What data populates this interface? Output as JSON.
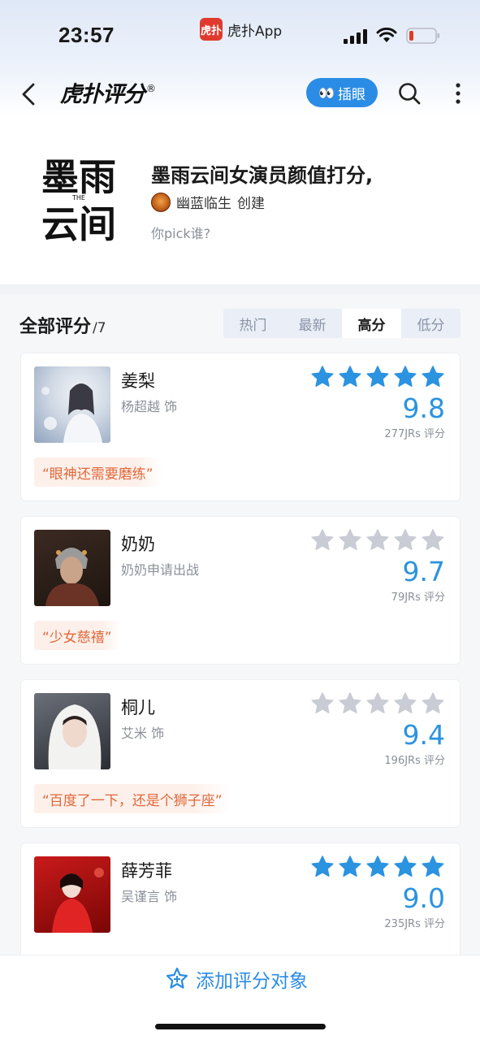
{
  "status_bar": {
    "time": "23:57",
    "app_logo_text": "虎扑",
    "app_name": "虎扑App",
    "icons": [
      "signal-icon",
      "wifi-icon",
      "battery-icon"
    ]
  },
  "nav": {
    "back_icon": "chevron-left-icon",
    "logo_text": "虎扑评分",
    "logo_mark": "®",
    "peek_button": {
      "icon": "eyes-icon",
      "label": "插眼"
    },
    "search_icon": "search-icon",
    "more_icon": "more-vertical-icon",
    "accent_color": "#2b8ce6"
  },
  "topic": {
    "cover_text": [
      "墨雨",
      "云间"
    ],
    "cover_small": "THE",
    "title": "墨雨云间女演员颜值打分,",
    "creator_name": "幽蓝临生",
    "creator_suffix": "创建",
    "description": "你pick谁?"
  },
  "ratings": {
    "heading": "全部评分",
    "count": "/7",
    "sort_tabs": [
      {
        "label": "热门",
        "active": false
      },
      {
        "label": "最新",
        "active": false
      },
      {
        "label": "高分",
        "active": true
      },
      {
        "label": "低分",
        "active": false
      }
    ],
    "items": [
      {
        "name": "姜梨",
        "subtitle": "杨超越 饰",
        "stars_filled": 5,
        "score": "9.8",
        "votes": "277JRs 评分",
        "quote": "“眼神还需要磨练”"
      },
      {
        "name": "奶奶",
        "subtitle": "奶奶申请出战",
        "stars_filled": 0,
        "score": "9.7",
        "votes": "79JRs 评分",
        "quote": "“少女慈禧”"
      },
      {
        "name": "桐儿",
        "subtitle": "艾米 饰",
        "stars_filled": 0,
        "score": "9.4",
        "votes": "196JRs 评分",
        "quote": "“百度了一下，还是个狮子座”"
      },
      {
        "name": "薛芳菲",
        "subtitle": "吴谨言 饰",
        "stars_filled": 5,
        "score": "9.0",
        "votes": "235JRs 评分",
        "quote": ""
      }
    ],
    "star_color_filled": "#2b93e0",
    "star_color_empty": "#c9ccd4",
    "score_color": "#2b93e0",
    "quote_color": "#e0673a"
  },
  "bottom": {
    "add_icon": "star-plus-icon",
    "add_label": "添加评分对象"
  }
}
